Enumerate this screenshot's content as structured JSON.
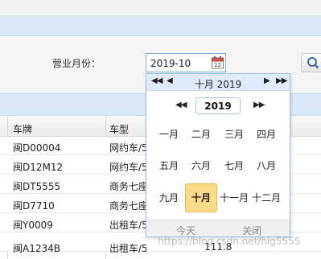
{
  "filter": {
    "label": "营业月份：",
    "month_value": "2019-10"
  },
  "grid": {
    "columns": [
      "车牌",
      "车型"
    ],
    "rows": [
      {
        "plate": "闽D00004",
        "type": "网约车/5",
        "num": ""
      },
      {
        "plate": "闽D12M12",
        "type": "网约车/5",
        "num": ""
      },
      {
        "plate": "闽DT5555",
        "type": "商务七座",
        "num": ""
      },
      {
        "plate": "闽D7710",
        "type": "商务七座",
        "num": ""
      },
      {
        "plate": "闽Y0009",
        "type": "出租车/5",
        "num": ""
      },
      {
        "plate": "闽A1234B",
        "type": "出租车/5座",
        "num": "111.8"
      }
    ]
  },
  "picker": {
    "title": "十月 2019",
    "year": "2019",
    "selected_month": "十月",
    "months": [
      "一月",
      "二月",
      "三月",
      "四月",
      "五月",
      "六月",
      "七月",
      "八月",
      "九月",
      "十月",
      "十一月",
      "十二月"
    ],
    "today_label": "今天",
    "close_label": "关闭"
  },
  "watermark": "https://blog.csdn.net/hlg5555",
  "colors": {
    "accent_band": "#dbe8f8",
    "selected_month": "#fbdb8a",
    "input_border": "#7eaee0"
  },
  "icons": {
    "calendar": "calendar-icon",
    "search": "search-icon"
  }
}
